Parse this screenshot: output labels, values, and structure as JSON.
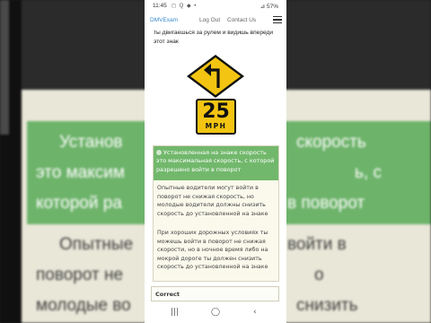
{
  "status_bar": {
    "time": "11:45",
    "left_icons": "◻ Q ◆ •",
    "right": "⊿ 57%"
  },
  "nav": {
    "brand": "DMVExam",
    "logout": "Log Out",
    "contact": "Contact Us"
  },
  "question_text": "ты двигаешься за рулем и видишь впереди этот знак",
  "sign": {
    "speed_value": "25",
    "speed_unit": "MPH"
  },
  "answer": {
    "text": "Установленная на знаке скорость это максимальная скорость, с которой разрешено войти в поворот"
  },
  "explanation": {
    "p1": "Опытные водители могут войти в поворот не снижая скорость, но молодые водители должны снизить скорость до установленной на знаке",
    "p2": "При хороших дорожных условиях ты можешь войти в поворот не снижая скорости, но в ночное время либо на мокрой дороге ты должен снизить скорость до установленной на знаке"
  },
  "result_label": "Correct",
  "background_text": {
    "line1": "Установ",
    "line1b": "скорость",
    "line2": "это максим",
    "line2b": "ь, с",
    "line3": "которой ра",
    "line3b": "в поворот",
    "line4": "Опытные",
    "line4b": "войти в",
    "line5": "поворот не",
    "line5b": "о",
    "line6": "молодые во",
    "line6b": "снизить"
  },
  "system_nav": {
    "recents": "|||",
    "home": "◯",
    "back": "‹"
  },
  "colors": {
    "accent_green": "#72b86c",
    "brand_blue": "#3a8ad0",
    "sign_yellow": "#f3c512"
  }
}
